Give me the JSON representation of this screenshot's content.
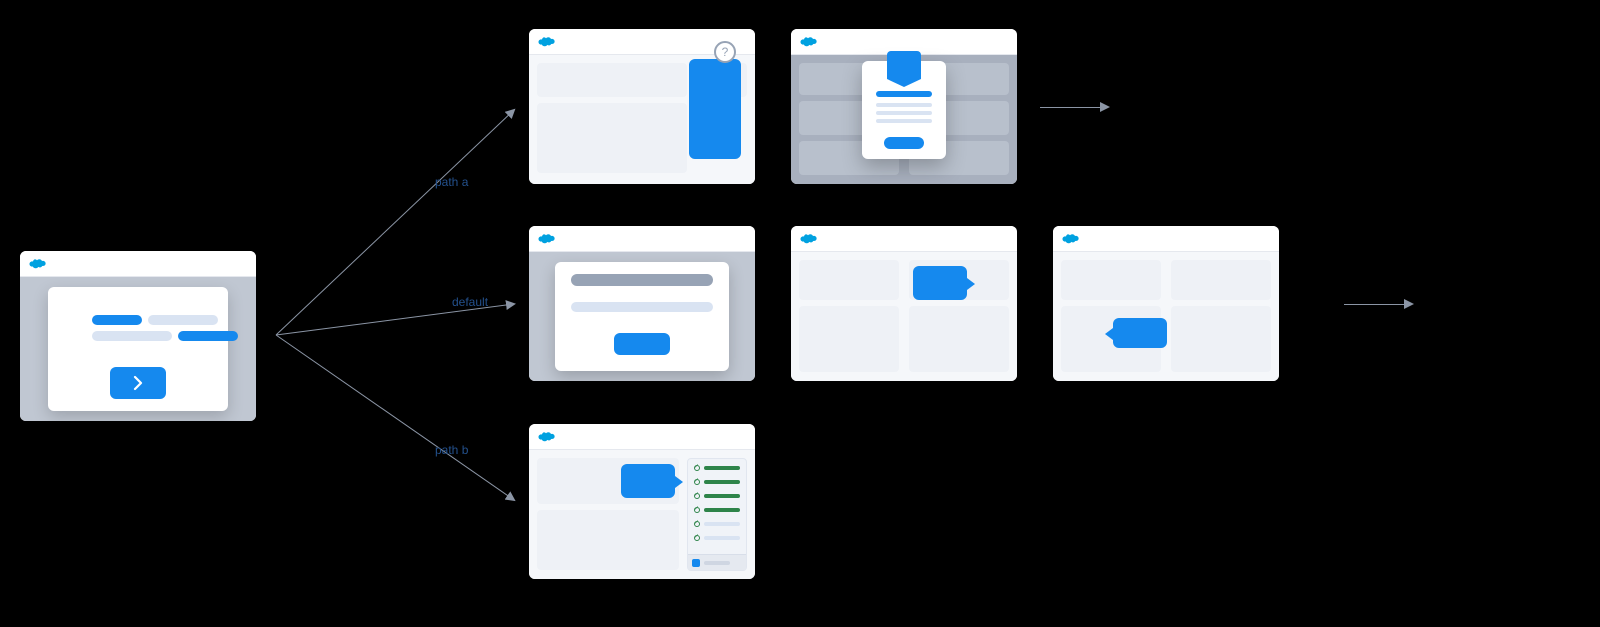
{
  "labels": {
    "path_a": "path a",
    "default": "default",
    "path_b": "path b"
  },
  "icons": {
    "cloud_color": "#00A1E0",
    "arrow_color": "#8b95a5",
    "accent_blue": "#1589ee"
  },
  "diagram": {
    "start": {
      "type": "decision-card"
    },
    "branches": [
      {
        "id": "a",
        "label_key": "path_a",
        "steps": [
          {
            "id": "a1",
            "type": "help-popover"
          },
          {
            "id": "a2",
            "type": "welcome-mat"
          }
        ],
        "continues": true
      },
      {
        "id": "default",
        "label_key": "default",
        "steps": [
          {
            "id": "d1",
            "type": "modal-prompt"
          },
          {
            "id": "d2",
            "type": "tooltip-right"
          },
          {
            "id": "d3",
            "type": "tooltip-left"
          }
        ],
        "continues": true
      },
      {
        "id": "b",
        "label_key": "path_b",
        "steps": [
          {
            "id": "b1",
            "type": "side-checklist-panel"
          }
        ],
        "continues": false
      }
    ]
  },
  "checklist": {
    "items": [
      {
        "status": "done"
      },
      {
        "status": "done"
      },
      {
        "status": "done"
      },
      {
        "status": "done"
      },
      {
        "status": "pending"
      },
      {
        "status": "pending"
      }
    ]
  }
}
